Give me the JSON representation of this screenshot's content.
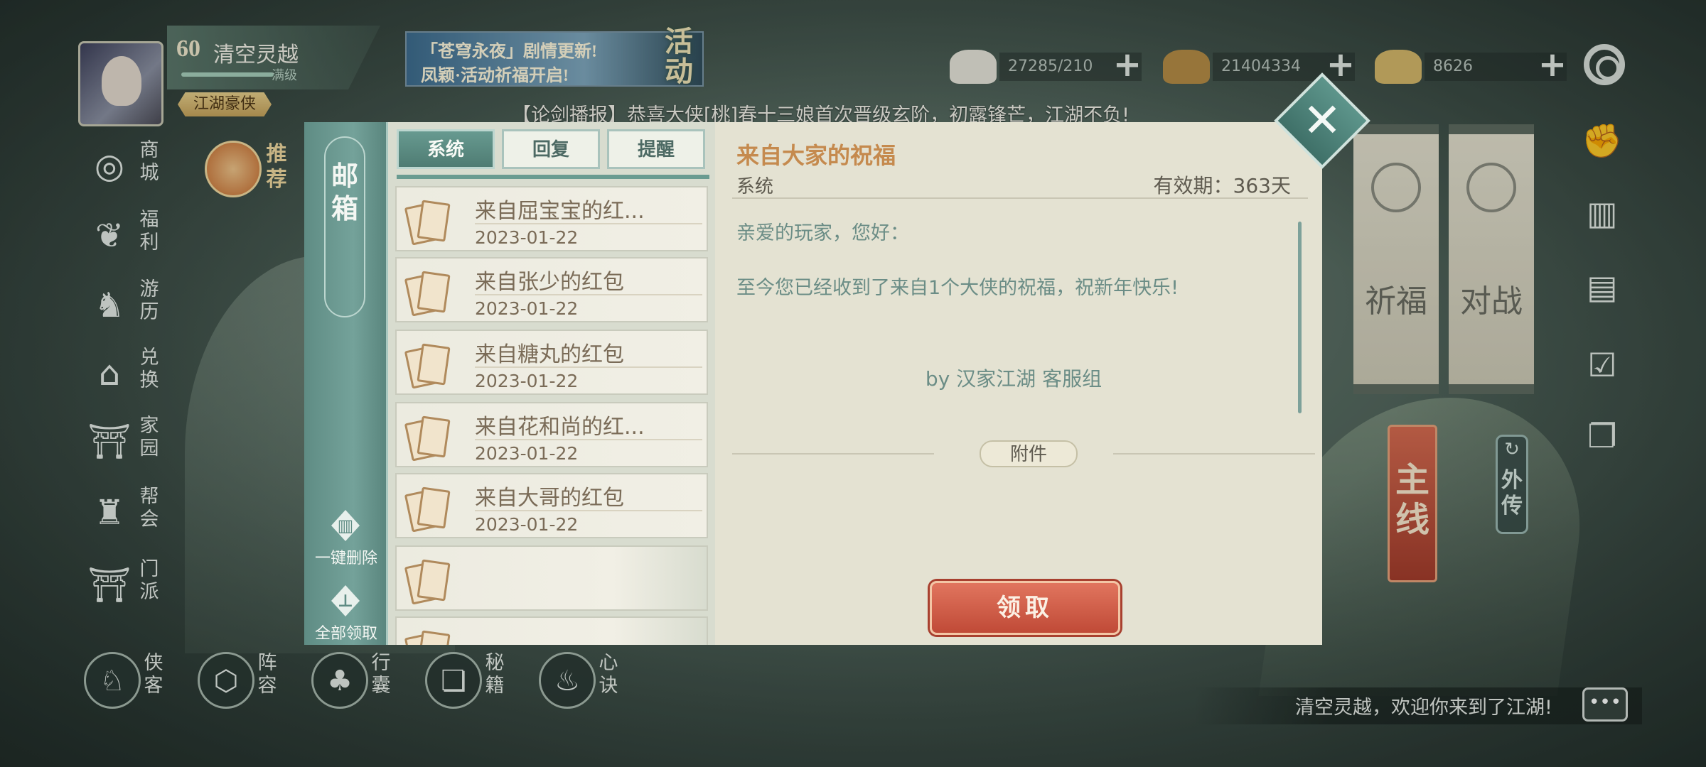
{
  "player": {
    "level": "60",
    "name": "清空灵越",
    "max_level_label": "满级",
    "title": "江湖豪侠"
  },
  "event_banner": {
    "line1": "「苍穹永夜」剧情更新!",
    "line2": "凤颖·活动祈福开启!",
    "label": "活动"
  },
  "currencies": [
    {
      "icon": "buns-icon",
      "value": "27285/210",
      "color": "#e8e6dc"
    },
    {
      "icon": "coins-icon",
      "value": "21404334",
      "color": "#b68b45"
    },
    {
      "icon": "ingot-icon",
      "value": "8626",
      "color": "#d6b86a"
    }
  ],
  "broadcast": "【论剑播报】恭喜大侠[桃]春十三娘首次晋级玄阶，初露锋芒，江湖不负!",
  "sidebar": {
    "items": [
      {
        "label": "商城",
        "icon": "shop-icon",
        "glyph": "◎"
      },
      {
        "label": "福利",
        "icon": "welfare-icon",
        "glyph": "❦"
      },
      {
        "label": "游历",
        "icon": "horse-icon",
        "glyph": "♞"
      },
      {
        "label": "兑换",
        "icon": "exchange-icon",
        "glyph": "⌂"
      },
      {
        "label": "家园",
        "icon": "home-icon",
        "glyph": "⛩"
      },
      {
        "label": "帮会",
        "icon": "guild-icon",
        "glyph": "♜"
      },
      {
        "label": "门派",
        "icon": "sect-icon",
        "glyph": "⛩"
      }
    ],
    "recommend": "推荐"
  },
  "bottom_bar": [
    {
      "label": "侠客",
      "icon": "hero-icon",
      "glyph": "♘"
    },
    {
      "label": "阵容",
      "icon": "formation-icon",
      "glyph": "⬡"
    },
    {
      "label": "行囊",
      "icon": "bag-icon",
      "glyph": "♣"
    },
    {
      "label": "秘籍",
      "icon": "book-icon",
      "glyph": "❏"
    },
    {
      "label": "心诀",
      "icon": "flame-icon",
      "glyph": "♨"
    }
  ],
  "right_side": {
    "banners": [
      "祈福",
      "对战"
    ],
    "main_quest": "主线",
    "side_story": "外传",
    "welcome": "清空灵越，欢迎你来到了江湖!"
  },
  "mailbox": {
    "title": "邮箱",
    "tabs": [
      "系统",
      "回复",
      "提醒"
    ],
    "active_tab": "系统",
    "delete_all": "一键删除",
    "claim_all": "全部领取",
    "items": [
      {
        "subject": "来自屈宝宝的红...",
        "date": "2023-01-22"
      },
      {
        "subject": "来自张少的红包",
        "date": "2023-01-22"
      },
      {
        "subject": "来自糖丸的红包",
        "date": "2023-01-22"
      },
      {
        "subject": "来自花和尚的红...",
        "date": "2023-01-22"
      },
      {
        "subject": "来自大哥的红包",
        "date": "2023-01-22"
      }
    ],
    "detail": {
      "title": "来自大家的祝福",
      "sender": "系统",
      "expiry": "有效期：363天",
      "greeting": "亲爱的玩家，您好：",
      "message": "至今您已经收到了来自1个大侠的祝福，祝新年快乐!",
      "signature": "by 汉家江湖 客服组",
      "attachment_label": "附件",
      "claim_button": "领取"
    }
  },
  "colors": {
    "accent_teal": "#5f8c84",
    "claim_red": "#c04a37",
    "title_orange": "#c58a4e"
  }
}
